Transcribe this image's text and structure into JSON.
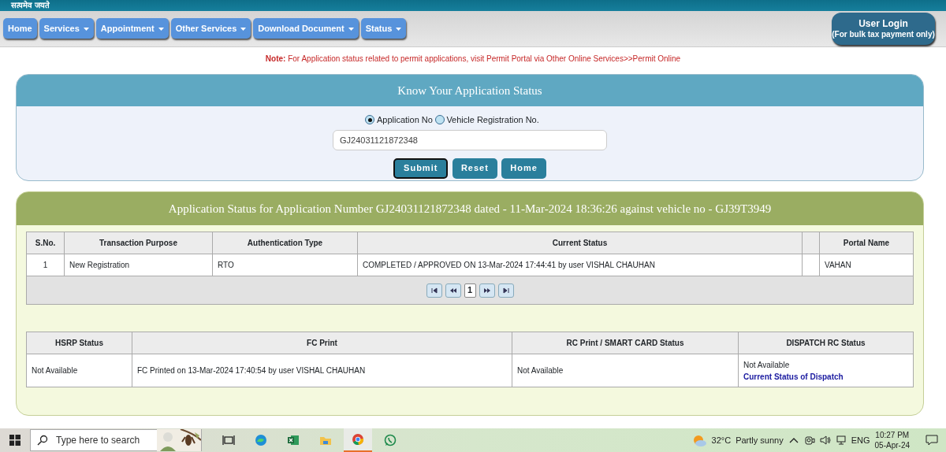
{
  "header": {
    "motto": "सत्यमेव जयते"
  },
  "nav": [
    {
      "label": "Home",
      "dropdown": false
    },
    {
      "label": "Services",
      "dropdown": true
    },
    {
      "label": "Appointment",
      "dropdown": true
    },
    {
      "label": "Other Services",
      "dropdown": true
    },
    {
      "label": "Download Document",
      "dropdown": true
    },
    {
      "label": "Status",
      "dropdown": true
    }
  ],
  "user_login": {
    "title": "User Login",
    "subtitle": "(For bulk tax payment only)"
  },
  "note": {
    "label": "Note:",
    "text": "For Application status related to permit applications, visit Permit Portal via Other Online Services>>Permit Online"
  },
  "search_panel": {
    "title": "Know Your Application Status",
    "options": [
      {
        "label": "Application No",
        "selected": true
      },
      {
        "label": "Vehicle Registration No.",
        "selected": false
      }
    ],
    "value": "GJ24031121872348",
    "buttons": [
      {
        "label": "Submit",
        "focused": true
      },
      {
        "label": "Reset",
        "focused": false
      },
      {
        "label": "Home",
        "focused": false
      }
    ]
  },
  "status_panel": {
    "title": "Application Status for Application Number GJ24031121872348 dated - 11-Mar-2024 18:36:26 against vehicle no - GJ39T3949",
    "table": {
      "columns": [
        {
          "label": "S.No."
        },
        {
          "label": "Transaction Purpose"
        },
        {
          "label": "Authentication Type"
        },
        {
          "label": "Current Status"
        },
        {},
        {
          "label": "Portal Name"
        }
      ],
      "rows": [
        {
          "cells": [
            "1",
            "New Registration",
            "RTO",
            "COMPLETED / APPROVED ON 13-Mar-2024 17:44:41 by user VISHAL CHAUHAN",
            null,
            "VAHAN"
          ]
        }
      ]
    },
    "pager": {
      "page": "1"
    },
    "table2": {
      "columns": [
        "HSRP Status",
        "FC Print",
        "RC Print / SMART CARD Status",
        "DISPATCH RC Status"
      ],
      "rows": [
        {
          "cells": [
            "Not Available",
            "FC Printed on 13-Mar-2024 17:40:54 by user VISHAL CHAUHAN",
            "Not Available",
            "Not Available"
          ],
          "link": "Current Status of Dispatch"
        }
      ]
    }
  },
  "taskbar": {
    "search_placeholder": "Type here to search",
    "apps": [
      {
        "kind": "taskview",
        "active": false
      },
      {
        "kind": "edge",
        "active": false
      },
      {
        "kind": "excel",
        "active": false
      },
      {
        "kind": "folder",
        "active": false
      },
      {
        "kind": "chrome",
        "active": true
      },
      {
        "kind": "whatsapp",
        "active": false
      }
    ],
    "weather": {
      "temp": "32°C",
      "text": "Partly sunny"
    },
    "lang": "ENG",
    "time": "10:27 PM",
    "date": "05-Apr-24"
  }
}
